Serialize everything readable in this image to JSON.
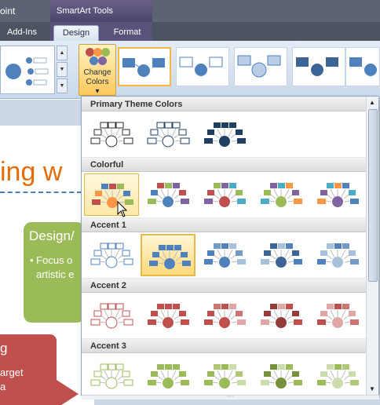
{
  "titlebar": {
    "app_fragment": "oint",
    "contextual_group": "SmartArt Tools"
  },
  "tabs": [
    {
      "label": "Add-Ins",
      "active": false
    },
    {
      "label": "Design",
      "active": true
    },
    {
      "label": "Format",
      "active": false
    }
  ],
  "ribbon": {
    "change_colors_line1": "Change",
    "change_colors_line2": "Colors",
    "dropdown_arrow": "▾"
  },
  "slide": {
    "title_fragment": "ing w",
    "green_box_heading": "Design/",
    "green_box_line1": "• Focus o",
    "green_box_line2": "artistic e",
    "red_box_heading": "g",
    "red_box_line1": "arget",
    "red_box_line2": "a"
  },
  "gallery": {
    "sections": [
      {
        "title": "Primary Theme Colors",
        "items": [
          {
            "style": "outline",
            "colors": [
              "#2b2b2b",
              "#2b2b2b",
              "#2b2b2b",
              "#2b2b2b"
            ]
          },
          {
            "style": "outline",
            "colors": [
              "#1f3f63",
              "#1f3f63",
              "#1f3f63",
              "#1f3f63"
            ]
          },
          {
            "style": "filled",
            "colors": [
              "#1f3f63",
              "#1f3f63",
              "#1f3f63",
              "#1f3f63"
            ]
          }
        ]
      },
      {
        "title": "Colorful",
        "items": [
          {
            "style": "filled",
            "colors": [
              "#4f81bd",
              "#c0504d",
              "#9bbb59",
              "#f79646"
            ]
          },
          {
            "style": "filled",
            "colors": [
              "#c0504d",
              "#9bbb59",
              "#8064a2",
              "#4f81bd"
            ]
          },
          {
            "style": "filled",
            "colors": [
              "#9bbb59",
              "#8064a2",
              "#4bacc6",
              "#c0504d"
            ]
          },
          {
            "style": "filled",
            "colors": [
              "#8064a2",
              "#4bacc6",
              "#f79646",
              "#9bbb59"
            ]
          },
          {
            "style": "filled",
            "colors": [
              "#4bacc6",
              "#f79646",
              "#4f81bd",
              "#8064a2"
            ]
          }
        ]
      },
      {
        "title": "Accent 1",
        "items": [
          {
            "style": "outline",
            "colors": [
              "#4f81bd",
              "#4f81bd",
              "#4f81bd",
              "#4f81bd"
            ]
          },
          {
            "style": "filled",
            "colors": [
              "#4f81bd",
              "#4f81bd",
              "#4f81bd",
              "#4f81bd"
            ]
          },
          {
            "style": "filled",
            "colors": [
              "#7399c6",
              "#4f81bd",
              "#a7c0de",
              "#4f81bd"
            ]
          },
          {
            "style": "filled",
            "colors": [
              "#3c6496",
              "#a7c0de",
              "#4f81bd",
              "#3c6496"
            ]
          },
          {
            "style": "filled",
            "colors": [
              "#a7c0de",
              "#4f81bd",
              "#7399c6",
              "#a7c0de"
            ]
          }
        ]
      },
      {
        "title": "Accent 2",
        "items": [
          {
            "style": "outline",
            "colors": [
              "#c0504d",
              "#c0504d",
              "#c0504d",
              "#c0504d"
            ]
          },
          {
            "style": "filled",
            "colors": [
              "#c0504d",
              "#c0504d",
              "#c0504d",
              "#c0504d"
            ]
          },
          {
            "style": "filled",
            "colors": [
              "#cd7371",
              "#c0504d",
              "#e0a7a6",
              "#c0504d"
            ]
          },
          {
            "style": "filled",
            "colors": [
              "#943c39",
              "#e0a7a6",
              "#c0504d",
              "#943c39"
            ]
          },
          {
            "style": "filled",
            "colors": [
              "#e0a7a6",
              "#c0504d",
              "#cd7371",
              "#e0a7a6"
            ]
          }
        ]
      },
      {
        "title": "Accent 3",
        "items": [
          {
            "style": "outline",
            "colors": [
              "#9bbb59",
              "#9bbb59",
              "#9bbb59",
              "#9bbb59"
            ]
          },
          {
            "style": "filled",
            "colors": [
              "#9bbb59",
              "#9bbb59",
              "#9bbb59",
              "#9bbb59"
            ]
          },
          {
            "style": "filled",
            "colors": [
              "#afc87a",
              "#9bbb59",
              "#cddcac",
              "#9bbb59"
            ]
          },
          {
            "style": "filled",
            "colors": [
              "#76923c",
              "#cddcac",
              "#9bbb59",
              "#76923c"
            ]
          },
          {
            "style": "filled",
            "colors": [
              "#cddcac",
              "#9bbb59",
              "#afc87a",
              "#cddcac"
            ]
          }
        ]
      }
    ],
    "hovered_item": "Colorful-0",
    "selected_item": "Accent 1-1"
  },
  "colors": {
    "accent_orange": "#e36c09",
    "hover_gold": "#e9b84c",
    "ribbon_blue": "#c9d8ea"
  }
}
